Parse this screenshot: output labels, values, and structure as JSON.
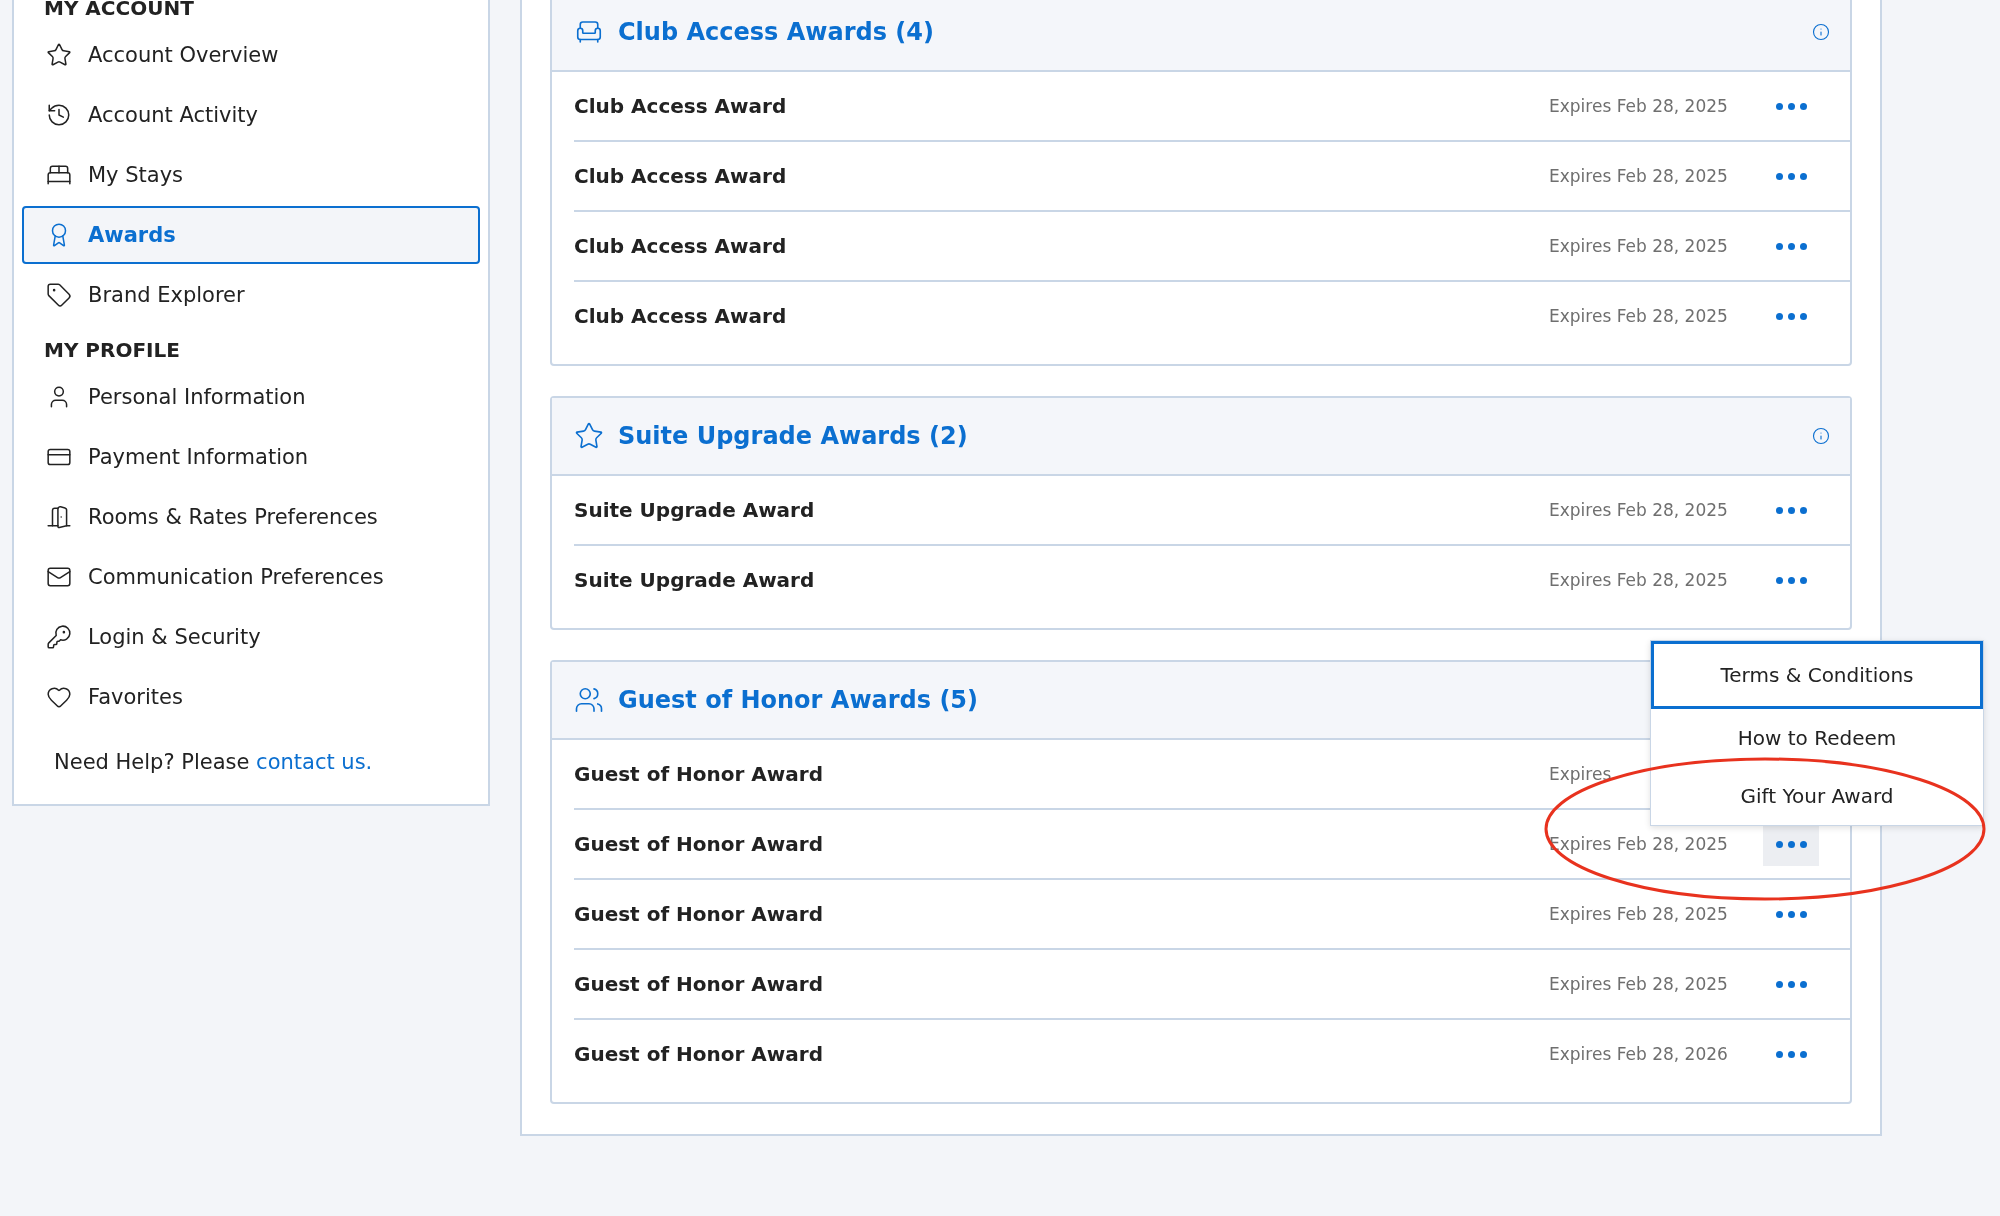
{
  "sidebar": {
    "groups": [
      {
        "title": "MY ACCOUNT",
        "items": [
          {
            "label": "Account Overview",
            "selected": false
          },
          {
            "label": "Account Activity",
            "selected": false
          },
          {
            "label": "My Stays",
            "selected": false
          },
          {
            "label": "Awards",
            "selected": true
          },
          {
            "label": "Brand Explorer",
            "selected": false
          }
        ]
      },
      {
        "title": "MY PROFILE",
        "items": [
          {
            "label": "Personal Information",
            "selected": false
          },
          {
            "label": "Payment Information",
            "selected": false
          },
          {
            "label": "Rooms & Rates Preferences",
            "selected": false
          },
          {
            "label": "Communication Preferences",
            "selected": false
          },
          {
            "label": "Login & Security",
            "selected": false
          },
          {
            "label": "Favorites",
            "selected": false
          }
        ]
      }
    ],
    "help": {
      "text": "Need Help? Please",
      "link": "contact us."
    }
  },
  "award_sections": [
    {
      "title": "Club Access Awards (4)",
      "info": true,
      "rows": [
        {
          "name": "Club Access Award",
          "expires": "Expires Feb 28, 2025",
          "menu_open": false
        },
        {
          "name": "Club Access Award",
          "expires": "Expires Feb 28, 2025",
          "menu_open": false
        },
        {
          "name": "Club Access Award",
          "expires": "Expires Feb 28, 2025",
          "menu_open": false
        },
        {
          "name": "Club Access Award",
          "expires": "Expires Feb 28, 2025",
          "menu_open": false
        }
      ]
    },
    {
      "title": "Suite Upgrade Awards (2)",
      "info": true,
      "rows": [
        {
          "name": "Suite Upgrade Award",
          "expires": "Expires Feb 28, 2025",
          "menu_open": false
        },
        {
          "name": "Suite Upgrade Award",
          "expires": "Expires Feb 28, 2025",
          "menu_open": false
        }
      ]
    },
    {
      "title": "Guest of Honor Awards (5)",
      "info": false,
      "rows": [
        {
          "name": "Guest of Honor Award",
          "expires": "Expires",
          "menu_open": false
        },
        {
          "name": "Guest of Honor Award",
          "expires": "Expires Feb 28, 2025",
          "menu_open": true
        },
        {
          "name": "Guest of Honor Award",
          "expires": "Expires Feb 28, 2025",
          "menu_open": false
        },
        {
          "name": "Guest of Honor Award",
          "expires": "Expires Feb 28, 2025",
          "menu_open": false
        },
        {
          "name": "Guest of Honor Award",
          "expires": "Expires Feb 28, 2026",
          "menu_open": false
        }
      ]
    }
  ],
  "action_menu": {
    "items": [
      {
        "label": "Terms & Conditions",
        "selected": true
      },
      {
        "label": "How to Redeem",
        "selected": false
      },
      {
        "label": "Gift Your Award",
        "selected": false
      }
    ]
  },
  "annotation": {
    "highlight": true
  }
}
